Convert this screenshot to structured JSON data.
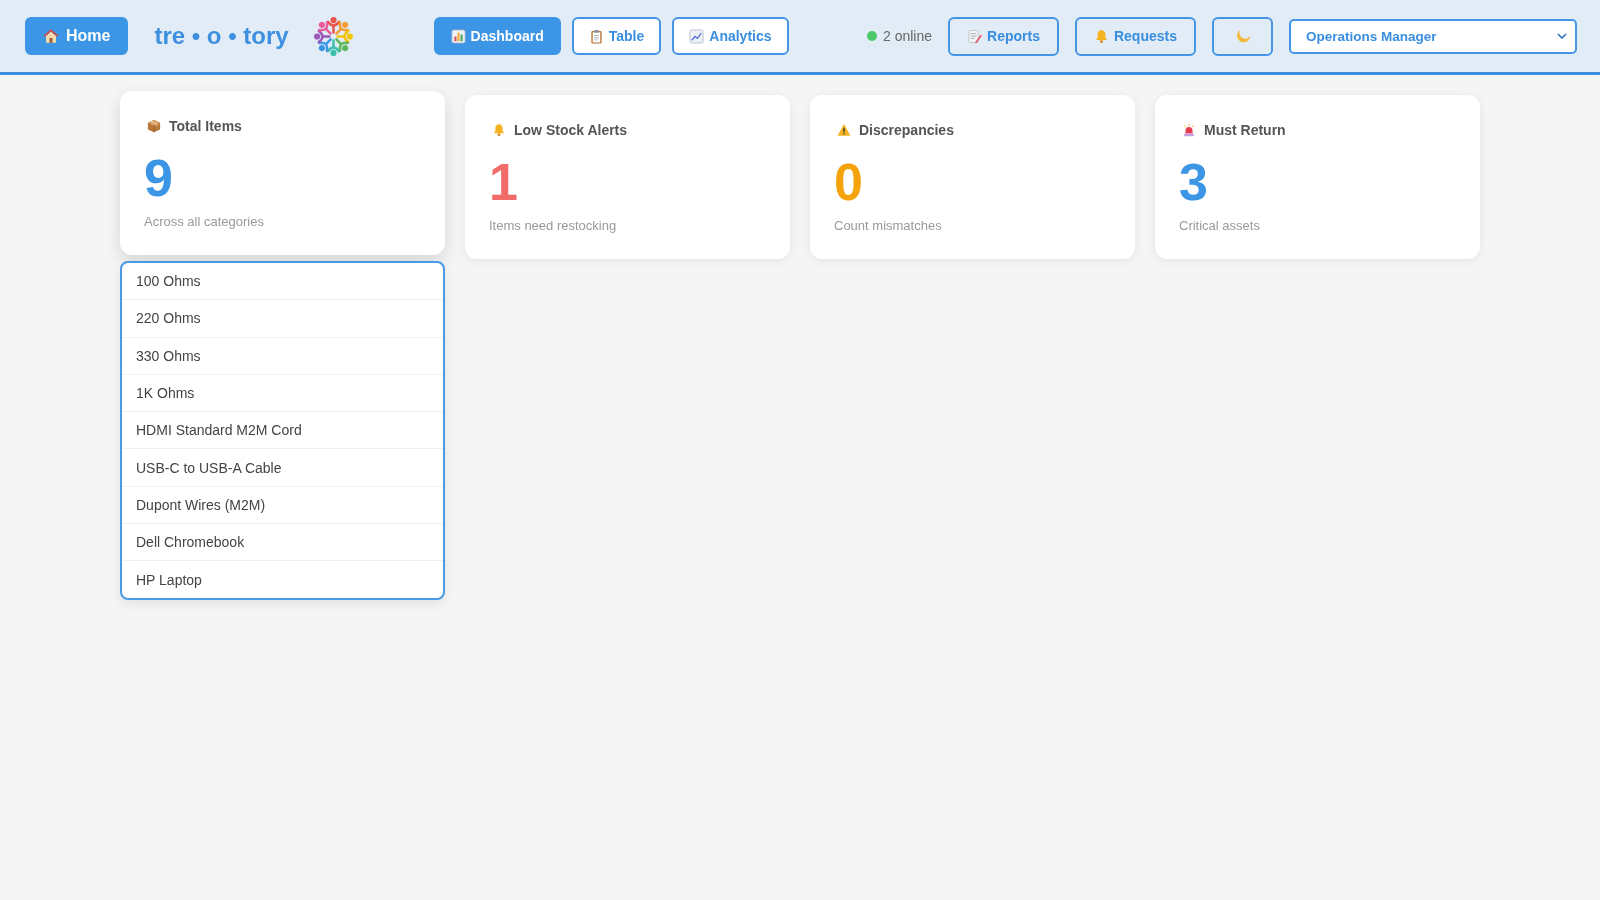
{
  "header": {
    "home_button": {
      "label": "Home"
    },
    "logo": {
      "text": "tre • o • tory"
    },
    "nav_tabs": [
      {
        "label": "Dashboard",
        "selected": true
      },
      {
        "label": "Table",
        "selected": false
      },
      {
        "label": "Analytics",
        "selected": false
      }
    ],
    "online_status": {
      "text": "2 online"
    },
    "actions": [
      {
        "label": "Reports"
      },
      {
        "label": "Requests"
      }
    ],
    "role_select": {
      "value": "Operations Manager"
    }
  },
  "stat_cards": [
    {
      "title": "Total Items",
      "value": "9",
      "caption": "Across all categories",
      "color": "#3d95e6",
      "dropdown": {
        "items": [
          {
            "label": "100 Ohms",
            "selected": false
          },
          {
            "label": "220 Ohms",
            "selected": false
          },
          {
            "label": "330 Ohms",
            "selected": false
          },
          {
            "label": "1K Ohms",
            "selected": false
          },
          {
            "label": "HDMI Standard M2M Cord",
            "selected": false
          },
          {
            "label": "USB-C to USB-A Cable",
            "selected": false
          },
          {
            "label": "Dupont Wires (M2M)",
            "selected": false
          },
          {
            "label": "Dell Chromebook",
            "selected": false
          },
          {
            "label": "HP Laptop",
            "selected": false
          }
        ]
      }
    },
    {
      "title": "Low Stock Alerts",
      "value": "1",
      "caption": "Items need restocking",
      "color": "#f26b6b"
    },
    {
      "title": "Discrepancies",
      "value": "0",
      "caption": "Count mismatches",
      "color": "#f5a30a"
    },
    {
      "title": "Must Return",
      "value": "3",
      "caption": "Critical assets",
      "color": "#3d95e6"
    }
  ]
}
